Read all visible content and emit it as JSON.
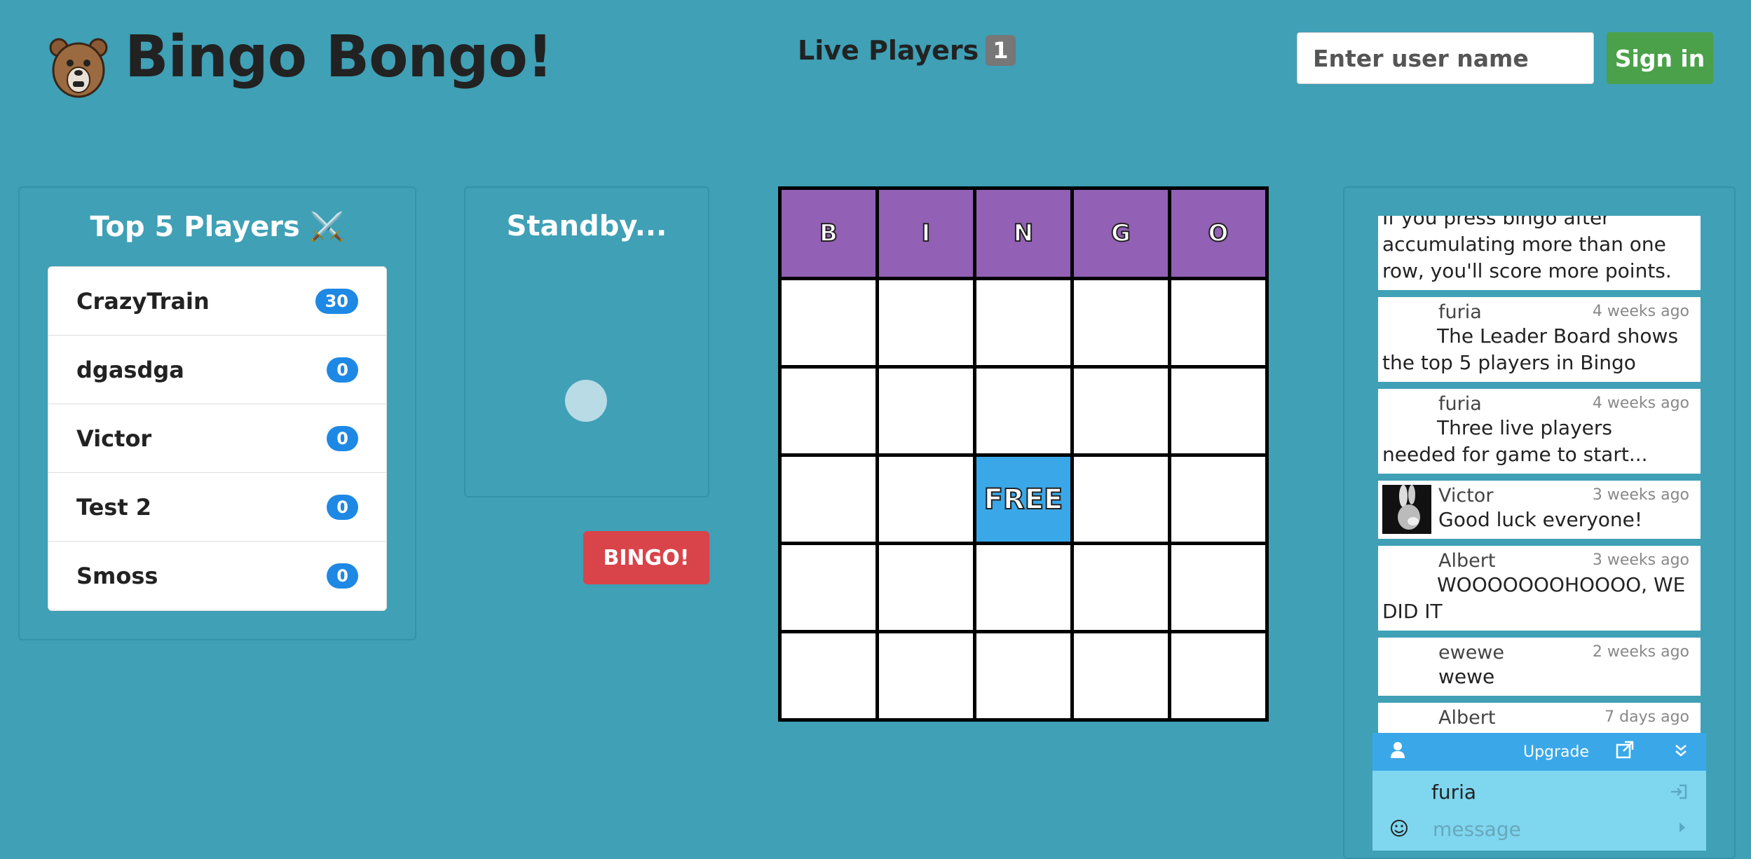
{
  "header": {
    "brand": "Bingo Bongo!",
    "live_label": "Live Players",
    "live_count": "1",
    "username_placeholder": "Enter user name",
    "signin_label": "Sign in"
  },
  "leaderboard": {
    "title": "Top 5 Players ⚔️",
    "players": [
      {
        "name": "CrazyTrain",
        "score": "30"
      },
      {
        "name": "dgasdga",
        "score": "0"
      },
      {
        "name": "Victor",
        "score": "0"
      },
      {
        "name": "Test 2",
        "score": "0"
      },
      {
        "name": "Smoss",
        "score": "0"
      }
    ]
  },
  "standby": {
    "title": "Standby...",
    "bingo_label": "BINGO!"
  },
  "card": {
    "headers": [
      "B",
      "I",
      "N",
      "G",
      "O"
    ],
    "free_label": "FREE"
  },
  "chat": {
    "messages": [
      {
        "author": "",
        "time": "",
        "text": "If you press bingo after accumulating more than one row, you'll score more points."
      },
      {
        "author": "furia",
        "time": "4 weeks ago",
        "text": "The Leader Board shows the top 5 players in Bingo"
      },
      {
        "author": "furia",
        "time": "4 weeks ago",
        "text": "Three live players needed for game to start..."
      },
      {
        "author": "Victor",
        "time": "3 weeks ago",
        "text": "Good luck everyone!"
      },
      {
        "author": "Albert",
        "time": "3 weeks ago",
        "text": "WOOOOOOOHOOOO, WE DID IT"
      },
      {
        "author": "ewewe",
        "time": "2 weeks ago",
        "text": "wewe"
      },
      {
        "author": "Albert",
        "time": "7 days ago",
        "text": ""
      }
    ],
    "upgrade_label": "Upgrade",
    "current_user": "furia",
    "message_placeholder": "message"
  }
}
